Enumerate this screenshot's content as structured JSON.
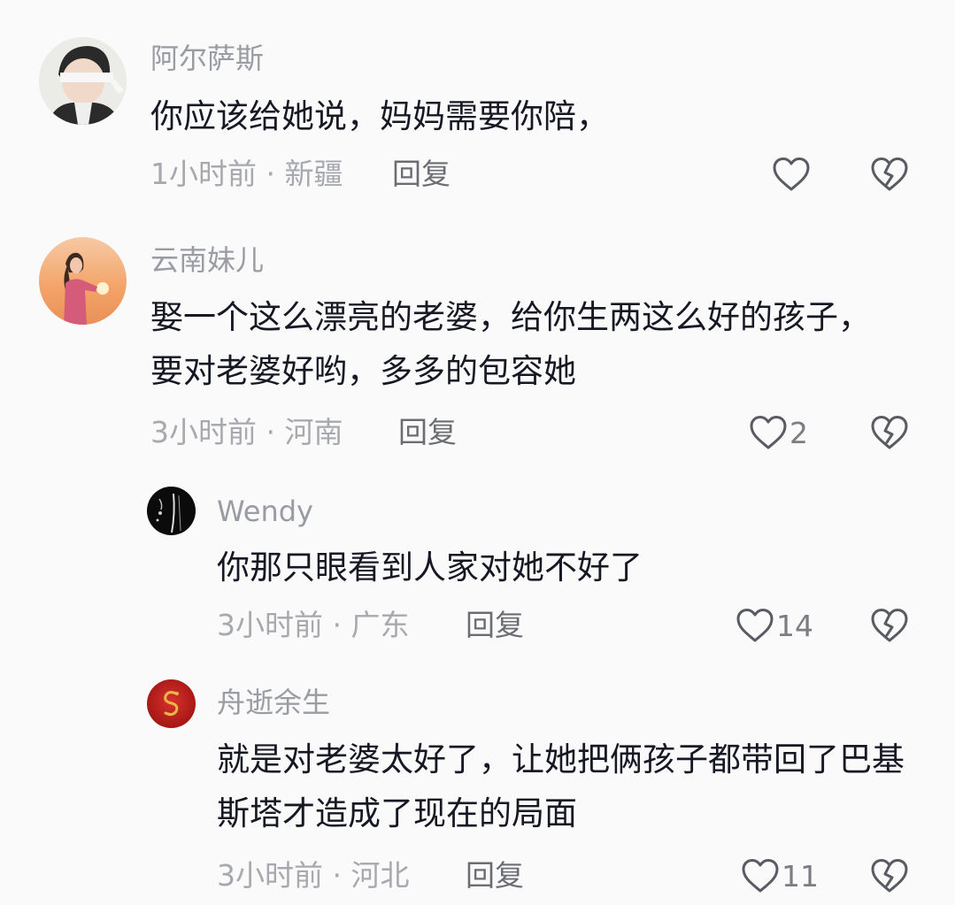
{
  "comments": [
    {
      "username": "阿尔萨斯",
      "text": "你应该给她说，妈妈需要你陪，",
      "time": "1小时前",
      "location": "新疆",
      "reply_label": "回复",
      "likes": ""
    },
    {
      "username": "云南妹儿",
      "text": "娶一个这么漂亮的老婆，给你生两这么好的孩子，要对老婆好哟，多多的包容她",
      "time": "3小时前",
      "location": "河南",
      "reply_label": "回复",
      "likes": "2"
    },
    {
      "username": "Wendy",
      "text": "你那只眼看到人家对她不好了",
      "time": "3小时前",
      "location": "广东",
      "reply_label": "回复",
      "likes": "14"
    },
    {
      "username": "舟逝余生",
      "text": "就是对老婆太好了，让她把俩孩子都带回了巴基斯塔才造成了现在的局面",
      "time": "3小时前",
      "location": "河北",
      "reply_label": "回复",
      "likes": "11"
    }
  ],
  "separator": " · ",
  "icons": {
    "like": "heart-outline-icon",
    "dislike": "broken-heart-icon"
  },
  "colors": {
    "background": "#fafafa",
    "text": "#161823",
    "muted": "#a7a9ae",
    "reply": "#6b6d73"
  }
}
